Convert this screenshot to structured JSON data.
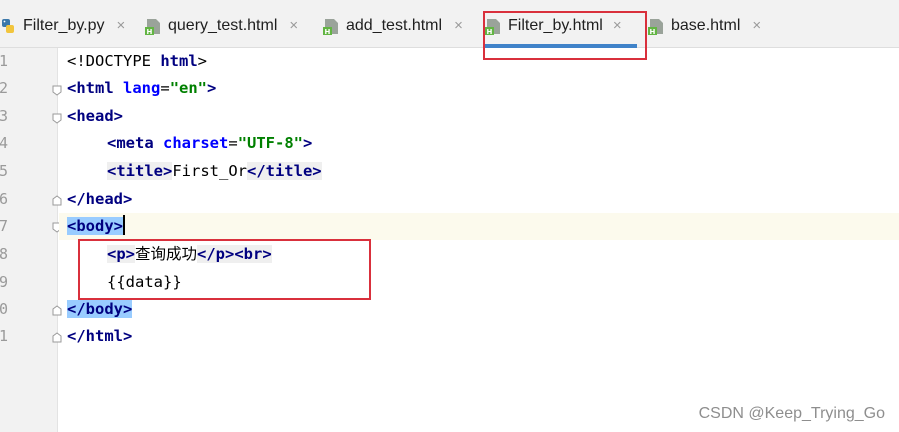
{
  "tabs": [
    {
      "label": "Filter_by.py",
      "icon": "python-file-icon",
      "active": false
    },
    {
      "label": "query_test.html",
      "icon": "html-file-icon",
      "active": false
    },
    {
      "label": "add_test.html",
      "icon": "html-file-icon",
      "active": false
    },
    {
      "label": "Filter_by.html",
      "icon": "html-file-icon",
      "active": true
    },
    {
      "label": "base.html",
      "icon": "html-file-icon",
      "active": false
    }
  ],
  "close_glyph": "×",
  "gutter": {
    "line_numbers": [
      "1",
      "2",
      "3",
      "4",
      "5",
      "6",
      "7",
      "8",
      "9",
      "0",
      "1"
    ]
  },
  "code": {
    "l1": {
      "open": "<!DOCTYPE ",
      "name": "html",
      "close": ">"
    },
    "l2": {
      "open": "<",
      "name": "html ",
      "attr": "lang",
      "eq": "=",
      "value": "\"en\"",
      "close": ">"
    },
    "l3": {
      "text": "<head>"
    },
    "l4": {
      "open": "<",
      "name": "meta ",
      "attr": "charset",
      "eq": "=",
      "value": "\"UTF-8\"",
      "close": ">"
    },
    "l5": {
      "open_tag": "<title>",
      "content": "First_Or",
      "close_tag": "</title>"
    },
    "l6": {
      "text": "</head>"
    },
    "l7": {
      "text": "<body>"
    },
    "l8": {
      "open_tag": "<p>",
      "content": "查询成功",
      "close_tag": "</p>",
      "br": "<br>"
    },
    "l9": {
      "text": "{{data}}"
    },
    "l10": {
      "text": "</body>"
    },
    "l11": {
      "text": "</html>"
    }
  },
  "watermark": "CSDN @Keep_Trying_Go",
  "colors": {
    "tag": "#000080",
    "attr": "#0000ff",
    "string": "#008000",
    "active_tab_underline": "#4083c9",
    "annotation_box": "#d9303c",
    "brace_match": "#99ccff"
  }
}
